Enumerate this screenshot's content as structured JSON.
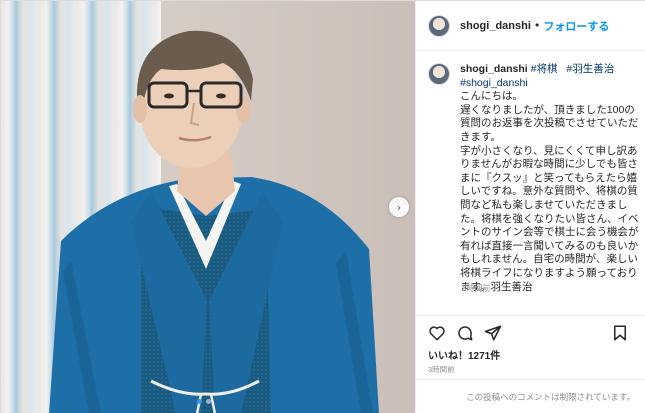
{
  "post": {
    "username": "shogi_danshi",
    "separator": "•",
    "follow_label": "フォローする",
    "caption_user": "shogi_danshi",
    "hashtags": [
      "#将棋",
      "#羽生善治",
      "#shogi_danshi"
    ],
    "caption_lines": [
      "こんにちは。",
      "遅くなりましたが、頂きました100の",
      "質問のお返事を次投稿でさせていただ",
      "きます。",
      "字が小さくなり、見にくくて申し訳あ",
      "りませんがお暇な時間に少しでも皆さ",
      "まに『クスッ』と笑ってもらえたら嬉",
      "しいですね。意外な質問や、将棋の質",
      "問など私も楽しませていただきまし",
      "た。将棋を強くなりたい皆さん、イベ",
      "ントのサイン会等で棋士に会う機会が",
      "有れば直接一言聞いてみるのも良いか",
      "もしれません。自宅の時間が、楽しい",
      "将棋ライフになりますよう願っており",
      "ます。羽生善治"
    ],
    "caption_time": "3時間前",
    "likes": "いいね！1271件",
    "post_date": "3時間前",
    "comments_disabled": "この投稿へのコメントは制限されています。"
  },
  "icons": {
    "like": "heart-icon",
    "comment": "comment-icon",
    "share": "share-icon",
    "save": "bookmark-icon",
    "next": "chevron-right-icon"
  },
  "carousel": {
    "total": 2,
    "active": 1
  },
  "colors": {
    "follow": "#0095f6",
    "hashtag": "#00376b",
    "kimono": "#1e6fa8",
    "muted": "#8e8e8e"
  }
}
